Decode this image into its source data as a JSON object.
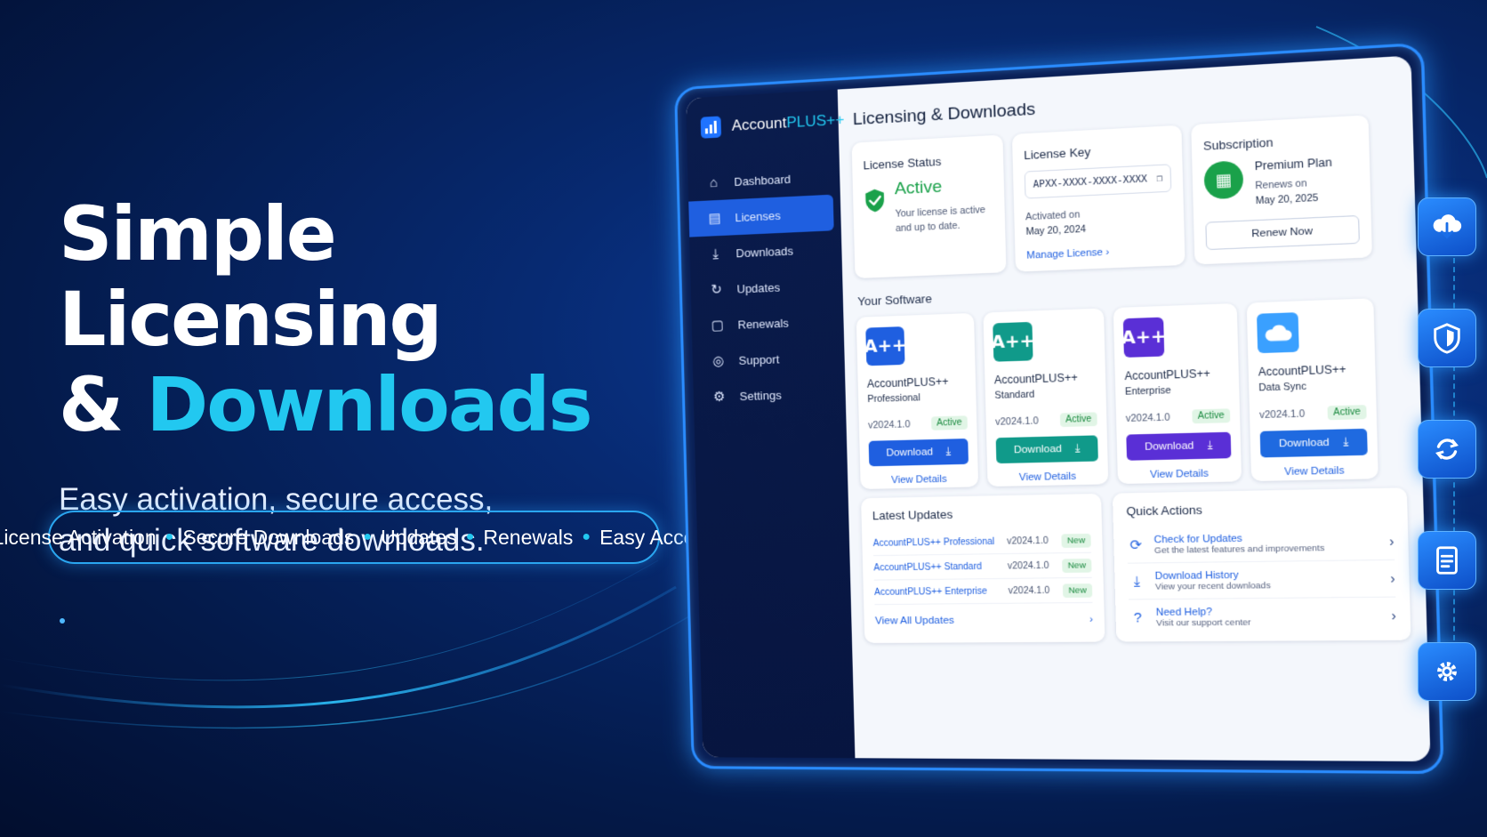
{
  "hero": {
    "title_line1": "Simple Licensing",
    "title_amp": "& ",
    "title_accent": "Downloads",
    "subtitle_line1": "Easy activation, secure access,",
    "subtitle_line2": "and quick software downloads."
  },
  "features": [
    "License Activation",
    "Secure Downloads",
    "Updates",
    "Renewals",
    "Easy Access"
  ],
  "app": {
    "brand_main": "Account",
    "brand_plus": "PLUS++",
    "nav": [
      {
        "label": "Dashboard",
        "icon": "home-icon"
      },
      {
        "label": "Licenses",
        "icon": "license-icon",
        "active": true
      },
      {
        "label": "Downloads",
        "icon": "download-icon"
      },
      {
        "label": "Updates",
        "icon": "refresh-icon"
      },
      {
        "label": "Renewals",
        "icon": "clipboard-icon"
      },
      {
        "label": "Support",
        "icon": "support-icon"
      },
      {
        "label": "Settings",
        "icon": "gear-icon"
      }
    ],
    "page_title": "Licensing & Downloads",
    "license_status": {
      "title": "License Status",
      "status": "Active",
      "desc": "Your license is active and up to date."
    },
    "license_key": {
      "title": "License Key",
      "key": "APXX-XXXX-XXXX-XXXX",
      "activated_label": "Activated on",
      "activated_date": "May 20, 2024",
      "manage": "Manage License"
    },
    "subscription": {
      "title": "Subscription",
      "plan": "Premium Plan",
      "renews_label": "Renews on",
      "renews_date": "May 20, 2025",
      "button": "Renew Now"
    },
    "software_title": "Your Software",
    "software": [
      {
        "icon_text": "A++",
        "name": "AccountPLUS++",
        "edition": "Professional",
        "version": "v2024.1.0",
        "status": "Active",
        "download": "Download",
        "details": "View Details",
        "color": "#1f5fe0"
      },
      {
        "icon_text": "A++",
        "name": "AccountPLUS++",
        "edition": "Standard",
        "version": "v2024.1.0",
        "status": "Active",
        "download": "Download",
        "details": "View Details",
        "color": "#109a8a"
      },
      {
        "icon_text": "A++",
        "name": "AccountPLUS++",
        "edition": "Enterprise",
        "version": "v2024.1.0",
        "status": "Active",
        "download": "Download",
        "details": "View Details",
        "color": "#5a2fd6"
      },
      {
        "icon_text": "",
        "name": "AccountPLUS++",
        "edition": "Data Sync",
        "version": "v2024.1.0",
        "status": "Active",
        "download": "Download",
        "details": "View Details",
        "color": "#1f6ae0"
      }
    ],
    "latest_updates": {
      "title": "Latest Updates",
      "items": [
        {
          "name": "AccountPLUS++ Professional",
          "version": "v2024.1.0",
          "badge": "New"
        },
        {
          "name": "AccountPLUS++ Standard",
          "version": "v2024.1.0",
          "badge": "New"
        },
        {
          "name": "AccountPLUS++ Enterprise",
          "version": "v2024.1.0",
          "badge": "New"
        }
      ],
      "view_all": "View All Updates"
    },
    "quick_actions": {
      "title": "Quick Actions",
      "items": [
        {
          "title": "Check for Updates",
          "desc": "Get the latest features and improvements",
          "icon": "update-check-icon"
        },
        {
          "title": "Download History",
          "desc": "View your recent downloads",
          "icon": "download-history-icon"
        },
        {
          "title": "Need Help?",
          "desc": "Visit our support center",
          "icon": "help-icon"
        }
      ]
    }
  },
  "rail_icons": [
    "cloud-download-icon",
    "shield-icon",
    "sync-icon",
    "document-icon",
    "gear-icon"
  ],
  "colors": {
    "accent": "#22c8f0",
    "primary": "#1f5fe0",
    "success": "#1aa14a",
    "background": "#041a4a"
  }
}
